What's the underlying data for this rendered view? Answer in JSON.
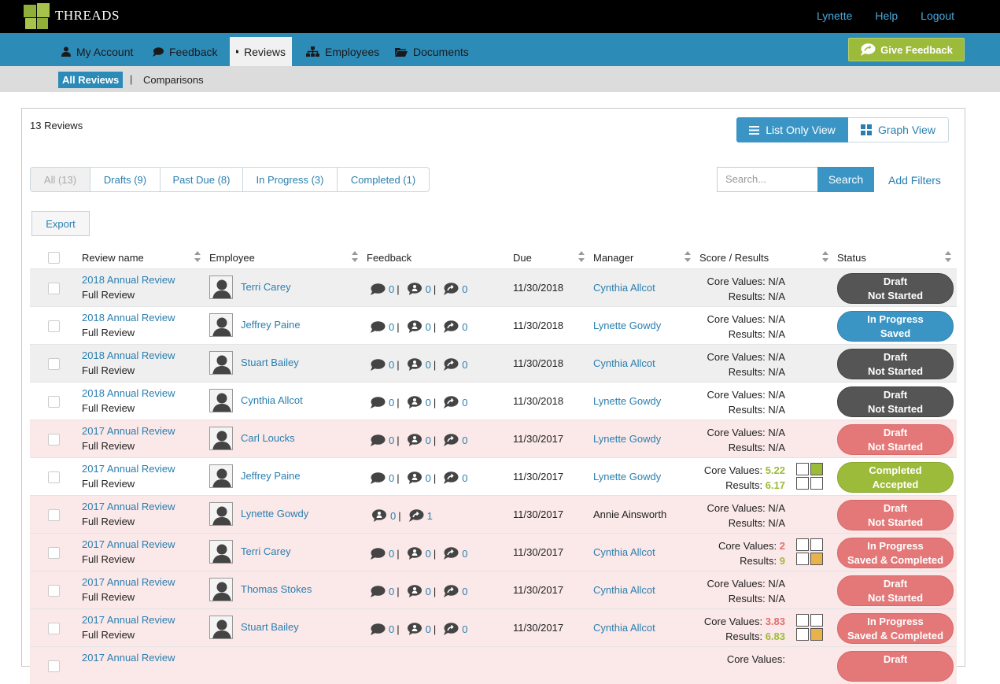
{
  "app": {
    "brand": "THREADS",
    "top_links": [
      "Lynette",
      "Help",
      "Logout"
    ]
  },
  "nav": {
    "items": [
      {
        "label": "My Account",
        "icon": "user-icon"
      },
      {
        "label": "Feedback",
        "icon": "speech-bubble-icon"
      },
      {
        "label": "Reviews",
        "icon": "document-icon"
      },
      {
        "label": "Employees",
        "icon": "org-chart-icon"
      },
      {
        "label": "Documents",
        "icon": "folder-icon"
      }
    ],
    "active": "Reviews",
    "give_feedback": "Give Feedback"
  },
  "subnav": {
    "active": "All Reviews",
    "separator": "|",
    "other": "Comparisons"
  },
  "panel": {
    "count": "13 Reviews",
    "views": {
      "list": "List Only View",
      "graph": "Graph View"
    },
    "filters": [
      "All (13)",
      "Drafts (9)",
      "Past Due (8)",
      "In Progress (3)",
      "Completed (1)"
    ],
    "search": {
      "placeholder": "Search...",
      "button": "Search"
    },
    "add_filters": "Add Filters",
    "export": "Export"
  },
  "table": {
    "headers": [
      "Review name",
      "Employee",
      "Feedback",
      "Due",
      "Manager",
      "Score / Results",
      "Status"
    ],
    "rows": [
      {
        "name": "2018 Annual Review",
        "type": "Full Review",
        "employee": "Terri Carey",
        "fb": [
          "0",
          "0",
          "0"
        ],
        "due": "11/30/2018",
        "manager": "Cynthia Allcot",
        "core_label": "Core Values:",
        "core": "N/A",
        "results_label": "Results:",
        "results": "N/A",
        "status1": "Draft",
        "status2": "Not Started"
      },
      {
        "name": "2018 Annual Review",
        "type": "Full Review",
        "employee": "Jeffrey Paine",
        "fb": [
          "0",
          "0",
          "0"
        ],
        "due": "11/30/2018",
        "manager": "Lynette Gowdy",
        "core_label": "Core Values:",
        "core": "N/A",
        "results_label": "Results:",
        "results": "N/A",
        "status1": "In Progress",
        "status2": "Saved"
      },
      {
        "name": "2018 Annual Review",
        "type": "Full Review",
        "employee": "Stuart Bailey",
        "fb": [
          "0",
          "0",
          "0"
        ],
        "due": "11/30/2018",
        "manager": "Cynthia Allcot",
        "core_label": "Core Values:",
        "core": "N/A",
        "results_label": "Results:",
        "results": "N/A",
        "status1": "Draft",
        "status2": "Not Started"
      },
      {
        "name": "2018 Annual Review",
        "type": "Full Review",
        "employee": "Cynthia Allcot",
        "fb": [
          "0",
          "0",
          "0"
        ],
        "due": "11/30/2018",
        "manager": "Lynette Gowdy",
        "core_label": "Core Values:",
        "core": "N/A",
        "results_label": "Results:",
        "results": "N/A",
        "status1": "Draft",
        "status2": "Not Started"
      },
      {
        "name": "2017 Annual Review",
        "type": "Full Review",
        "employee": "Carl Loucks",
        "fb": [
          "0",
          "0",
          "0"
        ],
        "due": "11/30/2017",
        "manager": "Lynette Gowdy",
        "core_label": "Core Values:",
        "core": "N/A",
        "results_label": "Results:",
        "results": "N/A",
        "status1": "Draft",
        "status2": "Not Started"
      },
      {
        "name": "2017 Annual Review",
        "type": "Full Review",
        "employee": "Jeffrey Paine",
        "fb": [
          "0",
          "0",
          "0"
        ],
        "due": "11/30/2017",
        "manager": "Lynette Gowdy",
        "core_label": "Core Values:",
        "core": "5.22",
        "results_label": "Results:",
        "results": "6.17",
        "status1": "Completed",
        "status2": "Accepted"
      },
      {
        "name": "2017 Annual Review",
        "type": "Full Review",
        "employee": "Lynette Gowdy",
        "fb": [
          "0",
          "1"
        ],
        "due": "11/30/2017",
        "manager": "Annie Ainsworth",
        "core_label": "Core Values:",
        "core": "N/A",
        "results_label": "Results:",
        "results": "N/A",
        "status1": "Draft",
        "status2": "Not Started"
      },
      {
        "name": "2017 Annual Review",
        "type": "Full Review",
        "employee": "Terri Carey",
        "fb": [
          "0",
          "0",
          "0"
        ],
        "due": "11/30/2017",
        "manager": "Cynthia Allcot",
        "core_label": "Core Values:",
        "core": "2",
        "results_label": "Results:",
        "results": "9",
        "status1": "In Progress",
        "status2": "Saved & Completed"
      },
      {
        "name": "2017 Annual Review",
        "type": "Full Review",
        "employee": "Thomas Stokes",
        "fb": [
          "0",
          "0",
          "0"
        ],
        "due": "11/30/2017",
        "manager": "Cynthia Allcot",
        "core_label": "Core Values:",
        "core": "N/A",
        "results_label": "Results:",
        "results": "N/A",
        "status1": "Draft",
        "status2": "Not Started"
      },
      {
        "name": "2017 Annual Review",
        "type": "Full Review",
        "employee": "Stuart Bailey",
        "fb": [
          "0",
          "0",
          "0"
        ],
        "due": "11/30/2017",
        "manager": "Cynthia Allcot",
        "core_label": "Core Values:",
        "core": "3.83",
        "results_label": "Results:",
        "results": "6.83",
        "status1": "In Progress",
        "status2": "Saved & Completed"
      },
      {
        "name": "2017 Annual Review",
        "type": "",
        "employee": "",
        "fb": [],
        "due": "",
        "manager": "",
        "core_label": "Core Values:",
        "core": "",
        "results_label": "",
        "results": "",
        "status1": "Draft",
        "status2": ""
      }
    ]
  },
  "colors": {
    "nav": "#2d8bb8",
    "accent_green": "#9dbb3b",
    "link": "#2a7fb0",
    "status_dark": "#555555",
    "status_red": "#e47878",
    "status_blue": "#3b95c4",
    "grid_orange": "#e8b34a"
  }
}
